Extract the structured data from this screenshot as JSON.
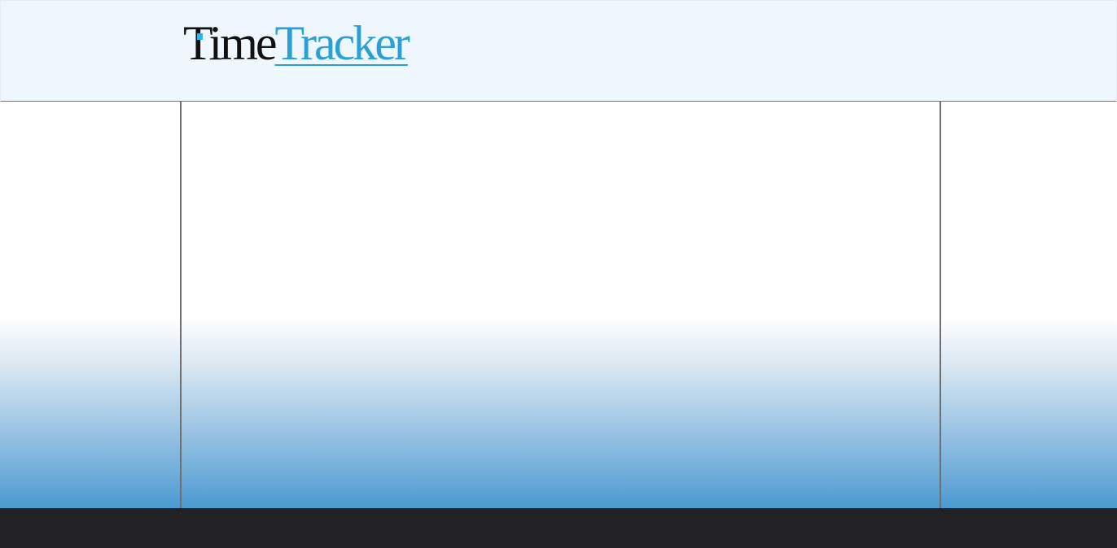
{
  "header": {
    "logo": {
      "text_dark": "Time",
      "text_blue": "Tracker"
    }
  },
  "colors": {
    "header_background": "#eef7fd",
    "brand_blue": "#2a9fd8",
    "brand_dark": "#111111",
    "gradient_bottom": "#4c9ad2",
    "footer_background": "#222224"
  }
}
